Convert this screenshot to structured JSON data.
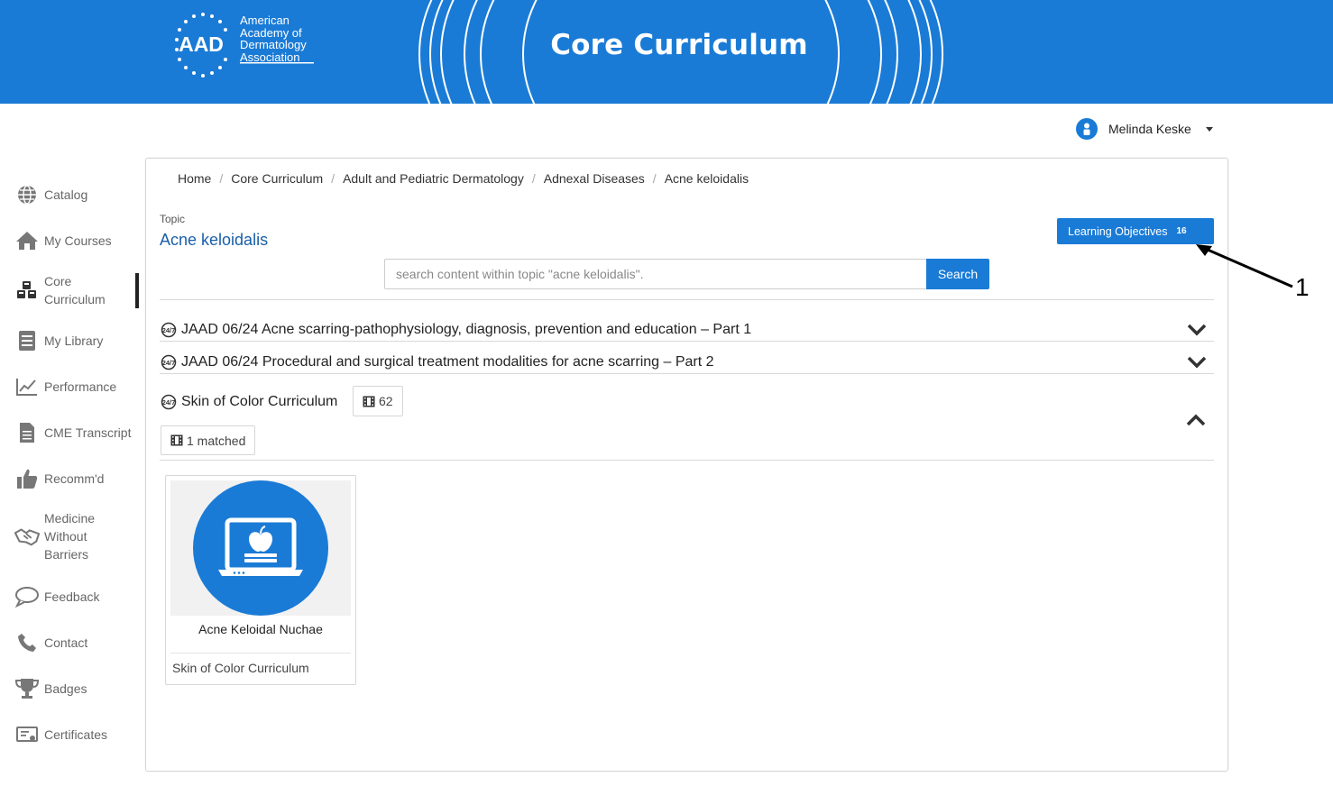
{
  "header": {
    "logo_mark": "AAD",
    "logo_lines": [
      "American",
      "Academy of",
      "Dermatology",
      "Association"
    ],
    "title": "Core Curriculum",
    "brand_color": "#1a7bd6"
  },
  "user": {
    "name": "Melinda Keske",
    "avatar_icon": "user-icon"
  },
  "sidebar": {
    "items": [
      {
        "label": "Catalog",
        "icon": "globe-icon"
      },
      {
        "label": "My Courses",
        "icon": "home-icon"
      },
      {
        "label": "Core Curriculum",
        "icon": "cubes-icon",
        "active": true
      },
      {
        "label": "My Library",
        "icon": "library-icon"
      },
      {
        "label": "Performance",
        "icon": "chart-icon"
      },
      {
        "label": "CME Transcript",
        "icon": "document-icon"
      },
      {
        "label": "Recomm'd",
        "icon": "thumbs-up-icon"
      },
      {
        "label": "Medicine Without Barriers",
        "icon": "handshake-icon"
      },
      {
        "label": "Feedback",
        "icon": "speech-bubble-icon"
      },
      {
        "label": "Contact",
        "icon": "phone-icon"
      },
      {
        "label": "Badges",
        "icon": "trophy-icon"
      },
      {
        "label": "Certificates",
        "icon": "certificate-icon"
      }
    ]
  },
  "breadcrumb": [
    "Home",
    "Core Curriculum",
    "Adult and Pediatric Dermatology",
    "Adnexal Diseases",
    "Acne keloidalis"
  ],
  "topic": {
    "label": "Topic",
    "title": "Acne keloidalis"
  },
  "learning_objectives": {
    "label": "Learning Objectives",
    "count": "16"
  },
  "search": {
    "placeholder": "search content within topic \"acne keloidalis\".",
    "button": "Search"
  },
  "sections": [
    {
      "title": "JAAD 06/24 Acne scarring-pathophysiology, diagnosis, prevention and education – Part 1",
      "expanded": false
    },
    {
      "title": "JAAD 06/24 Procedural and surgical treatment modalities for acne scarring – Part 2",
      "expanded": false
    },
    {
      "title": "Skin of Color Curriculum",
      "expanded": true,
      "count": "62",
      "matched": "1 matched"
    }
  ],
  "course": {
    "title": "Acne Keloidal Nuchae",
    "collection": "Skin of Color Curriculum"
  },
  "annotation": {
    "number": "1"
  }
}
